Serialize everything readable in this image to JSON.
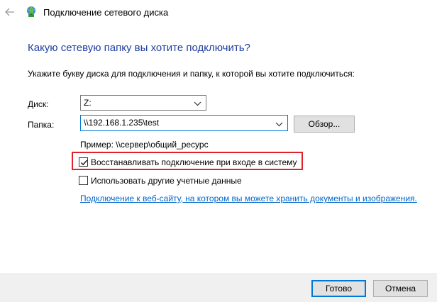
{
  "window": {
    "title": "Подключение сетевого диска"
  },
  "icons": {
    "back": "back-arrow-icon",
    "network": "network-drive-icon"
  },
  "main": {
    "heading": "Какую сетевую папку вы хотите подключить?",
    "instruction": "Укажите букву диска для подключения и папку, к которой вы хотите подключиться:",
    "drive_label": "Диск:",
    "drive_value": "Z:",
    "folder_label": "Папка:",
    "folder_value": "\\\\192.168.1.235\\test",
    "browse_label": "Обзор...",
    "example": "Пример: \\\\сервер\\общий_ресурс",
    "reconnect_label": "Восстанавливать подключение при входе в систему",
    "reconnect_checked": true,
    "other_creds_label": "Использовать другие учетные данные",
    "other_creds_checked": false,
    "link_text": "Подключение к веб-сайту, на котором вы можете хранить документы и изображения."
  },
  "footer": {
    "ok_label": "Готово",
    "cancel_label": "Отмена"
  },
  "colors": {
    "heading": "#1f3fa0",
    "link": "#0066cc",
    "highlight": "#e0232b",
    "accent": "#0078d7"
  }
}
